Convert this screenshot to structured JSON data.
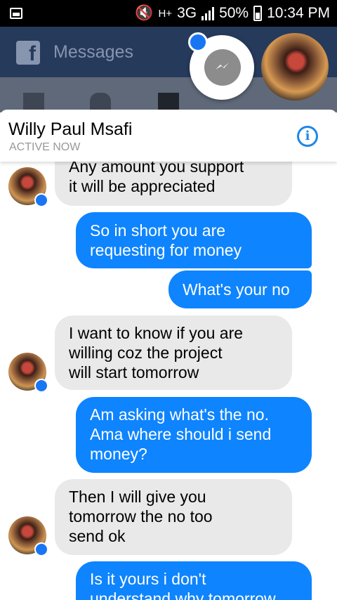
{
  "status_bar": {
    "network_small": "H+",
    "network": "3G",
    "battery": "50%",
    "time": "10:34 PM"
  },
  "app_header": {
    "title": "Messages",
    "logo": "f",
    "tabs": [
      "news-feed-icon",
      "friends-icon",
      "messages-icon",
      "notifications-icon",
      "more-icon"
    ]
  },
  "conversation": {
    "name": "Willy Paul Msafi",
    "status": "ACTIVE NOW",
    "info_icon": "i"
  },
  "colors": {
    "outgoing": "#0e84fe",
    "incoming": "#e9e9ea",
    "header": "#263a5c"
  },
  "messages": [
    {
      "from": "them",
      "lines": [
        "Any amount you support",
        "it will be appreciated"
      ]
    },
    {
      "from": "me",
      "lines": [
        "So in short you are",
        "requesting for money"
      ]
    },
    {
      "from": "me",
      "lines": [
        "What's your no"
      ]
    },
    {
      "from": "them",
      "lines": [
        "I want to know if you are",
        "willing coz the project",
        "will start tomorrow"
      ]
    },
    {
      "from": "me",
      "lines": [
        "Am asking what's the no.",
        "Ama where should i send",
        "money?"
      ]
    },
    {
      "from": "them",
      "lines": [
        "Then I will give you",
        "tomorrow the no too",
        "send ok"
      ]
    },
    {
      "from": "me",
      "lines": [
        "Is it yours i don't",
        "understand why tomorrow"
      ]
    }
  ]
}
